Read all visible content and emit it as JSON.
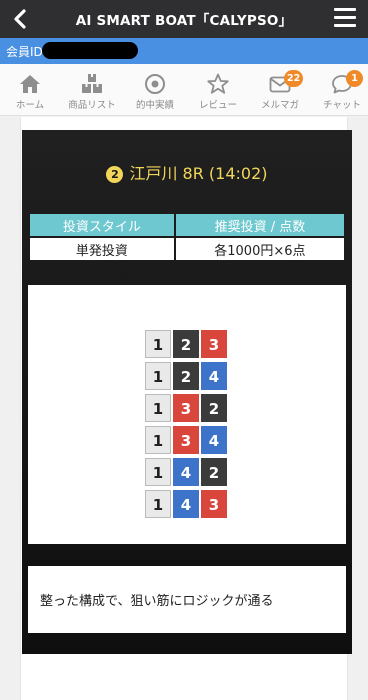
{
  "header": {
    "title": "AI SMART BOAT「CALYPSO」"
  },
  "member": {
    "label": "会員ID"
  },
  "nav": [
    {
      "label": "ホーム",
      "icon": "home-icon"
    },
    {
      "label": "商品リスト",
      "icon": "boxes-icon"
    },
    {
      "label": "的中実績",
      "icon": "target-icon"
    },
    {
      "label": "レビュー",
      "icon": "star-icon"
    },
    {
      "label": "メルマガ",
      "icon": "mail-icon",
      "badge": "22"
    },
    {
      "label": "チャット",
      "icon": "chat-icon",
      "badge": "1"
    }
  ],
  "race": {
    "number": "2",
    "title": "江戸川 8R (14:02)"
  },
  "investment": {
    "headers": [
      "投資スタイル",
      "推奨投資 / 点数"
    ],
    "values": [
      "単発投資",
      "各1000円×6点"
    ]
  },
  "picks": [
    [
      "1",
      "2",
      "3"
    ],
    [
      "1",
      "2",
      "4"
    ],
    [
      "1",
      "3",
      "2"
    ],
    [
      "1",
      "3",
      "4"
    ],
    [
      "1",
      "4",
      "2"
    ],
    [
      "1",
      "4",
      "3"
    ]
  ],
  "boat_colors": {
    "1": "#e9e9e9",
    "2": "#3b3b3b",
    "3": "#d9473c",
    "4": "#3d74c9"
  },
  "comment": "整った構成で、狙い筋にロジックが通る"
}
